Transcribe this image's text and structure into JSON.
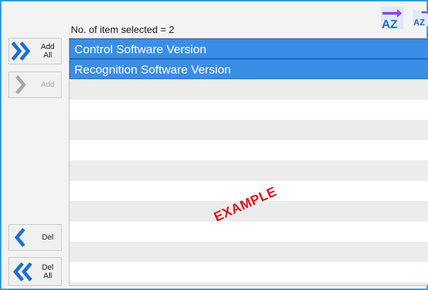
{
  "header": {
    "selection_count_text": "No. of item selected = 2"
  },
  "sort_buttons": [
    {
      "label": "AZ",
      "icon": "sort-ascending-icon"
    },
    {
      "label": "AZ",
      "icon": "sort-descending-icon"
    }
  ],
  "side_buttons": {
    "add_all": {
      "label": "Add\nAll",
      "icon": "double-chevron-right-icon",
      "enabled": true
    },
    "add": {
      "label": "Add",
      "icon": "chevron-right-icon",
      "enabled": false
    },
    "del": {
      "label": "Del",
      "icon": "chevron-left-icon",
      "enabled": true
    },
    "del_all": {
      "label": "Del\nAll",
      "icon": "double-chevron-left-icon",
      "enabled": true
    }
  },
  "list": {
    "items": [
      {
        "label": "Control Software Version",
        "selected": true
      },
      {
        "label": "Recognition Software Version",
        "selected": true
      }
    ]
  },
  "watermark": "EXAMPLE",
  "colors": {
    "selection": "#3a8ee6",
    "accent_blue": "#2f9bd6",
    "watermark": "#d9181e"
  }
}
